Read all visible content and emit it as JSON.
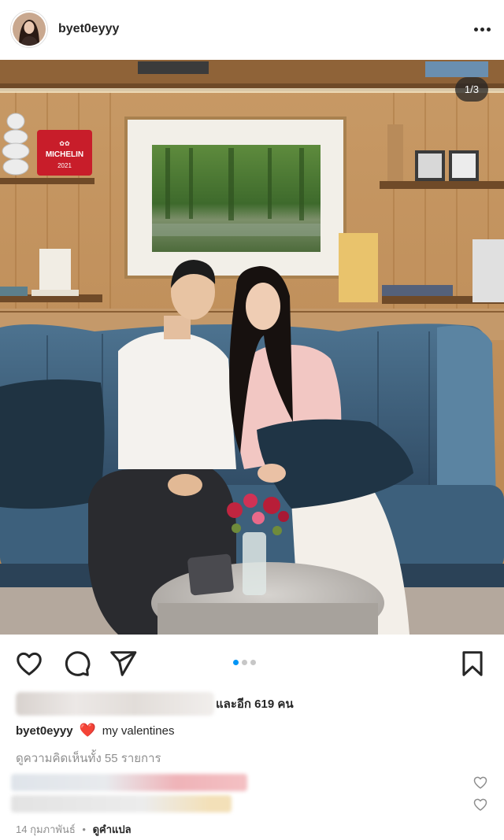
{
  "header": {
    "username": "byet0eyyy",
    "more_icon": "more-horizontal-icon"
  },
  "photo": {
    "counter": "1/3",
    "sign_text": "MICHELIN",
    "sign_year": "2021",
    "carousel_active_index": 0,
    "carousel_count": 3
  },
  "actions": {
    "like_icon": "heart-outline-icon",
    "comment_icon": "comment-bubble-icon",
    "share_icon": "paper-plane-icon",
    "save_icon": "bookmark-icon"
  },
  "likes": {
    "text": "และอีก 619 คน"
  },
  "caption": {
    "username": "byet0eyyy",
    "emoji": "❤️",
    "text": "my valentines"
  },
  "comments": {
    "view_all": "ดูความคิดเห็นทั้ง 55 รายการ"
  },
  "footer": {
    "date": "14 กุมภาพันธ์",
    "separator": "•",
    "translate": "ดูคำแปล"
  },
  "colors": {
    "accent": "#0095f6",
    "muted": "#8e8e8e",
    "text": "#262626",
    "heart": "#e0202e"
  }
}
